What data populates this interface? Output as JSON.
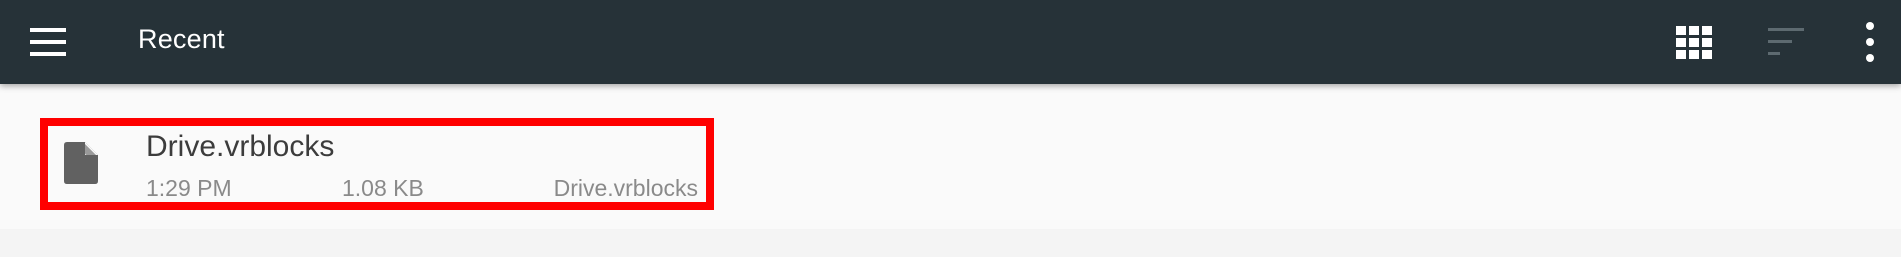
{
  "toolbar": {
    "title": "Recent",
    "background": "#263238",
    "icons": {
      "menu": "hamburger-menu-icon",
      "grid": "grid-view-icon",
      "sort": "sort-icon",
      "more": "more-vert-icon"
    }
  },
  "files": [
    {
      "name": "Drive.vrblocks",
      "time": "1:29 PM",
      "size": "1.08 KB",
      "source": "Drive.vrblocks",
      "icon": "file-icon"
    }
  ],
  "colors": {
    "highlight": "#ff0000",
    "icon": "#616161",
    "secondary_text": "#8a8a8a"
  }
}
